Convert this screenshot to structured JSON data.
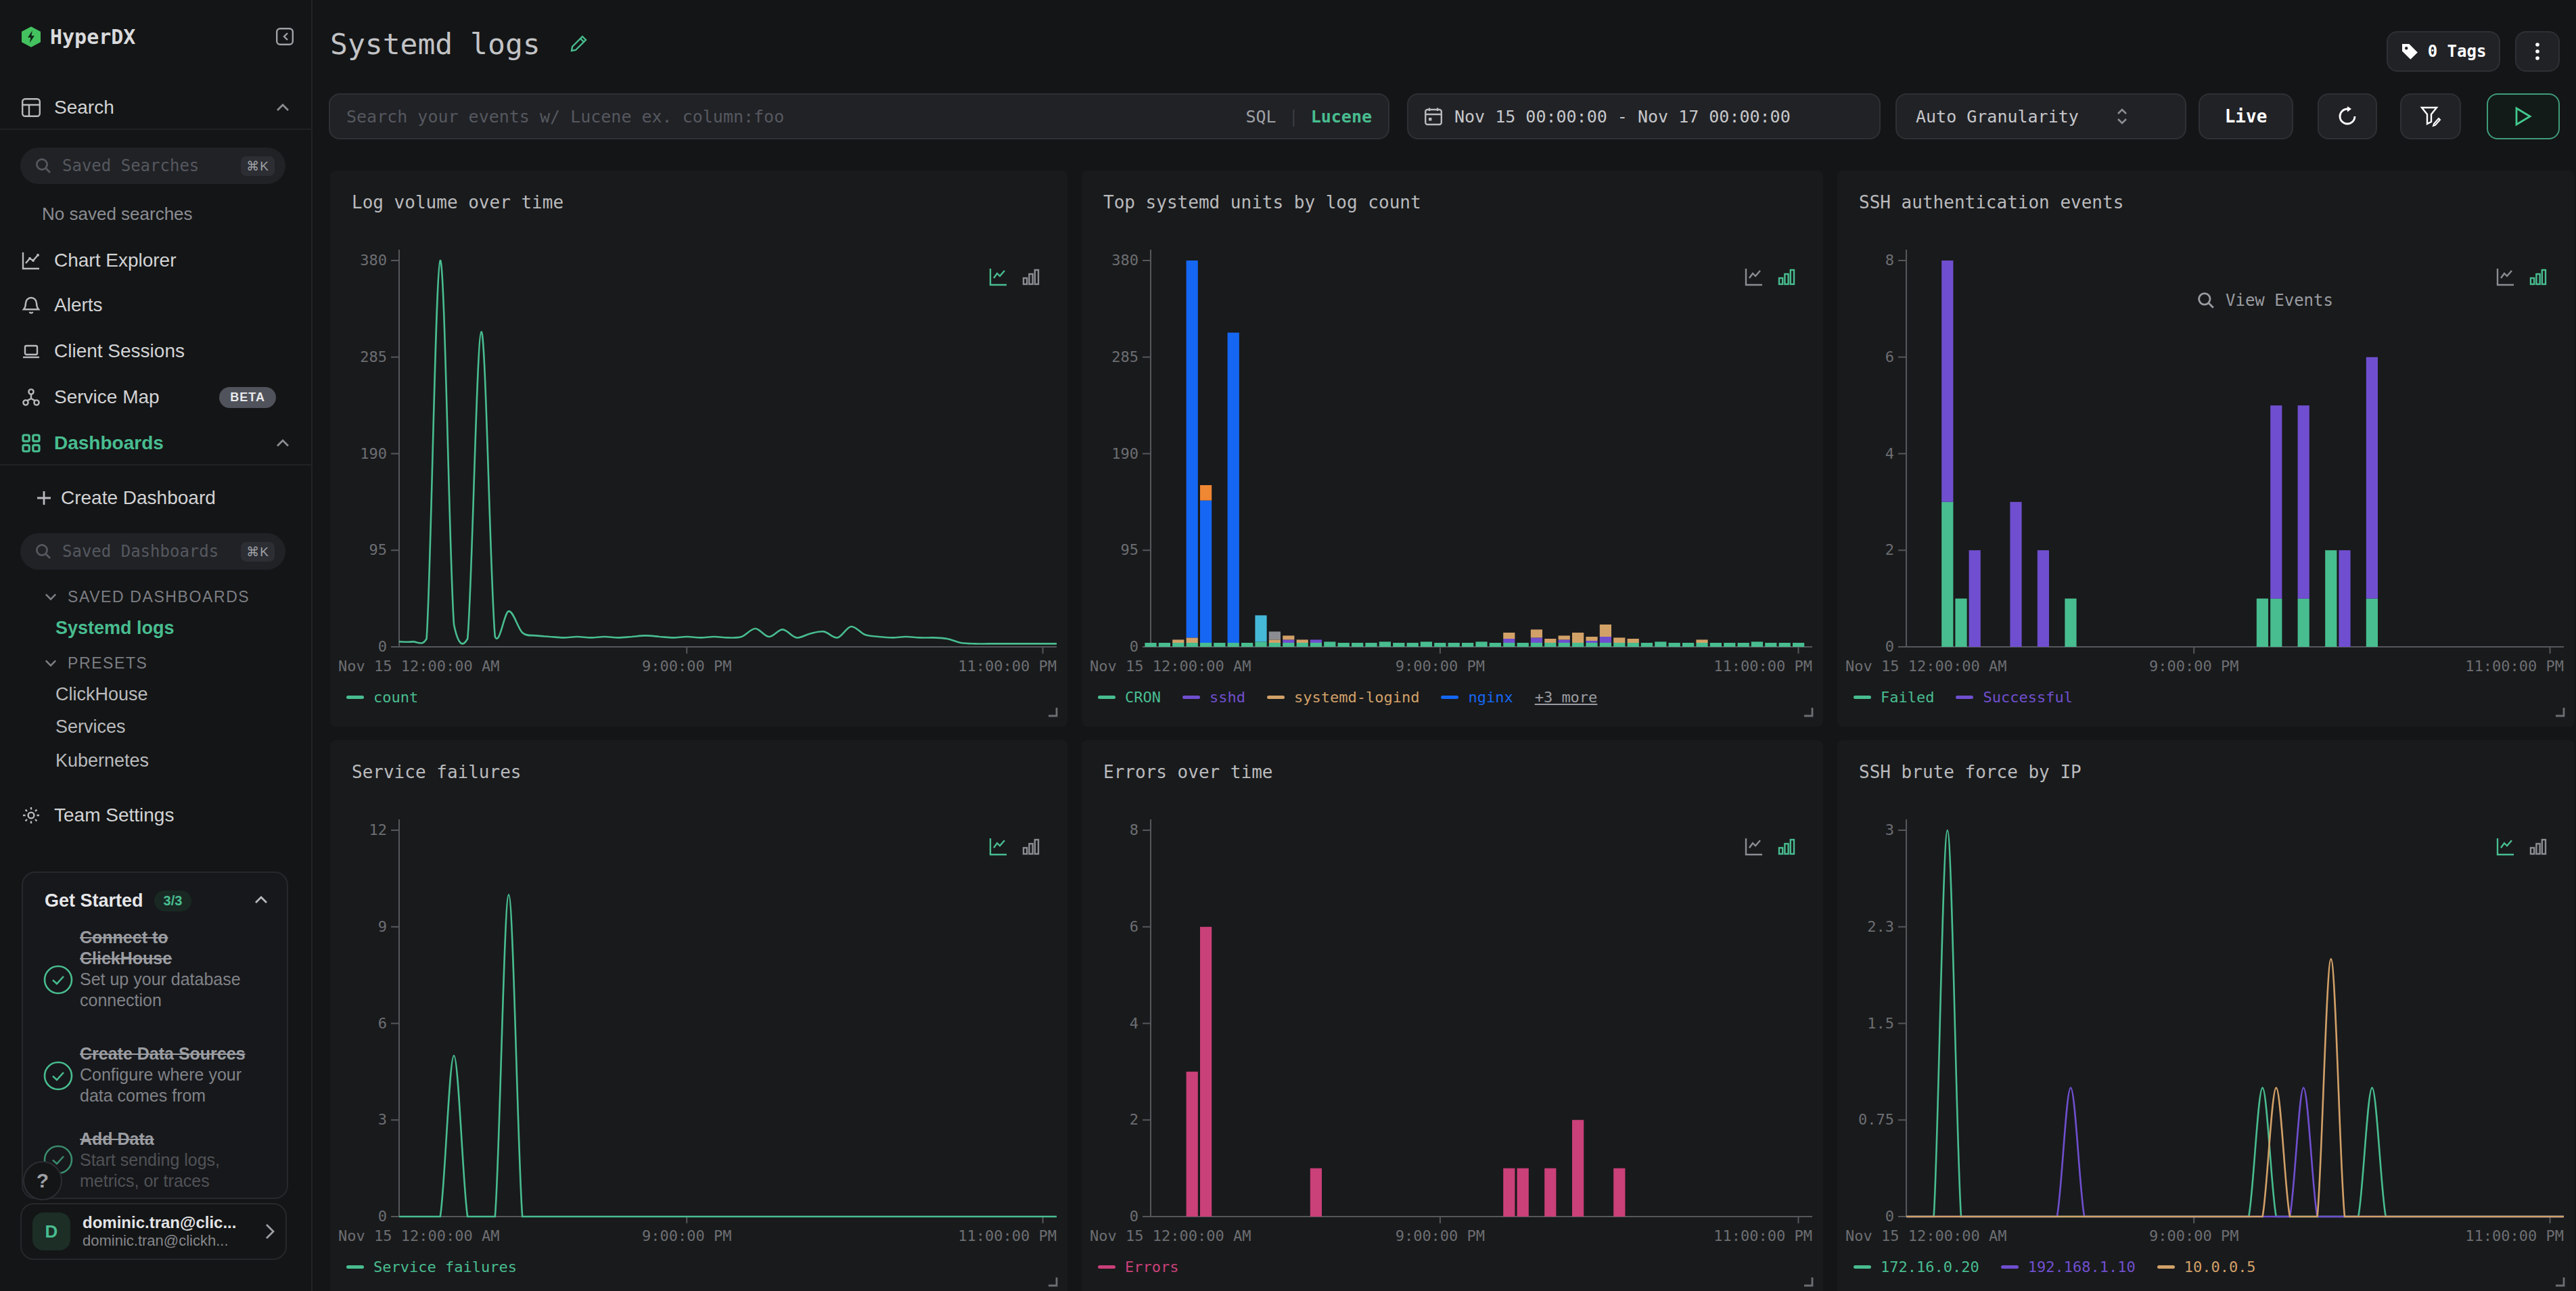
{
  "sidebar": {
    "logo": "HyperDX",
    "nav": [
      {
        "label": "Search"
      },
      {
        "label": "Chart Explorer"
      },
      {
        "label": "Alerts"
      },
      {
        "label": "Client Sessions"
      },
      {
        "label": "Service Map",
        "badge": "BETA"
      },
      {
        "label": "Dashboards"
      }
    ],
    "saved_searches": {
      "placeholder": "Saved Searches",
      "kbd": "⌘K"
    },
    "no_saved_searches": "No saved searches",
    "create_dashboard": "Create Dashboard",
    "saved_dashboards": {
      "placeholder": "Saved Dashboards",
      "kbd": "⌘K"
    },
    "sections": {
      "saved": "SAVED DASHBOARDS",
      "presets": "PRESETS"
    },
    "saved_dashboard_items": [
      "Systemd logs"
    ],
    "preset_items": [
      "ClickHouse",
      "Services",
      "Kubernetes"
    ],
    "team_settings": "Team Settings",
    "get_started": {
      "title": "Get Started",
      "progress": "3/3",
      "items": [
        {
          "title": "Connect to ClickHouse",
          "title_lines": [
            "Connect to",
            "ClickHouse"
          ],
          "subtitle_lines": [
            "Set up your database",
            "connection"
          ]
        },
        {
          "title": "Create Data Sources",
          "title_lines": [
            "Create Data Sources"
          ],
          "subtitle_lines": [
            "Configure where your",
            "data comes from"
          ]
        },
        {
          "title": "Add Data",
          "title_lines": [
            "Add Data"
          ],
          "subtitle_lines": [
            "Start sending logs,",
            "metrics, or traces"
          ]
        }
      ]
    },
    "help": "?",
    "user": {
      "initial": "D",
      "name": "dominic.tran@clic...",
      "email": "dominic.tran@clickh..."
    }
  },
  "header": {
    "title": "Systemd logs",
    "tags": "0 Tags"
  },
  "toolbar": {
    "search_placeholder": "Search your events w/ Lucene ex. column:foo",
    "sql": "SQL",
    "divider": "|",
    "lucene": "Lucene",
    "date_range": "Nov 15 00:00:00 - Nov 17 00:00:00",
    "granularity": "Auto Granularity",
    "live": "Live"
  },
  "colors": {
    "accent": "#48bd90",
    "green": "#48bd90",
    "blue": "#1567f3",
    "purple": "#6f4fcf",
    "pink": "#ca4079",
    "tan": "#d2a168",
    "orange": "#ef8733",
    "cyan": "#45b8d8",
    "gray": "#8b8d93",
    "panel": "#191a1c",
    "bg": "#141516",
    "input": "#212226"
  },
  "chart_data": [
    {
      "type": "line",
      "title": "Log volume over time",
      "active_view": "line",
      "ylim": [
        0,
        380
      ],
      "yticks": [
        "0",
        "95",
        "190",
        "285",
        "380"
      ],
      "x_labels": [
        "Nov 15 12:00:00 AM",
        "9:00:00 PM",
        "11:00:00 PM"
      ],
      "legend": [
        {
          "label": "count",
          "color": "green"
        }
      ],
      "series": [
        {
          "name": "count",
          "color": "green",
          "values": [
            5,
            5,
            8,
            380,
            22,
            8,
            310,
            10,
            35,
            14,
            11,
            10,
            9,
            10,
            9,
            10,
            9,
            10,
            11,
            10,
            9,
            10,
            9,
            10,
            9,
            10,
            18,
            10,
            17,
            9,
            13,
            15,
            9,
            20,
            12,
            10,
            9,
            10,
            9,
            9,
            8,
            4,
            3,
            3,
            3,
            3,
            3,
            3
          ]
        }
      ]
    },
    {
      "type": "bar",
      "title": "Top systemd units by log count",
      "active_view": "bar",
      "ylim": [
        0,
        380
      ],
      "yticks": [
        "0",
        "95",
        "190",
        "285",
        "380"
      ],
      "x_labels": [
        "Nov 15 12:00:00 AM",
        "9:00:00 PM",
        "11:00:00 PM"
      ],
      "legend": [
        {
          "label": "CRON",
          "color": "green"
        },
        {
          "label": "sshd",
          "color": "purple"
        },
        {
          "label": "systemd-logind",
          "color": "tan"
        },
        {
          "label": "nginx",
          "color": "blue"
        },
        {
          "label": "+3 more",
          "link": true
        }
      ],
      "series": [
        {
          "name": "CRON",
          "color": "green",
          "values": [
            4,
            4,
            4,
            4,
            4,
            4,
            4,
            4,
            5,
            4,
            4,
            4,
            4,
            5,
            4,
            4,
            4,
            5,
            4,
            4,
            5,
            4,
            4,
            4,
            5,
            4,
            4,
            4,
            4,
            4,
            4,
            4,
            4,
            4,
            4,
            4,
            4,
            5,
            4,
            4,
            4,
            4,
            4,
            4,
            5,
            4,
            4,
            4
          ]
        },
        {
          "name": "sshd",
          "color": "purple",
          "values": [
            0,
            0,
            0,
            0,
            0,
            0,
            0,
            0,
            0,
            0,
            3,
            0,
            3,
            0,
            0,
            0,
            0,
            0,
            0,
            0,
            0,
            0,
            0,
            0,
            0,
            0,
            4,
            0,
            5,
            0,
            3,
            0,
            2,
            6,
            0,
            0,
            0,
            0,
            0,
            0,
            0,
            0,
            0,
            0,
            0,
            0,
            0,
            0
          ]
        },
        {
          "name": "systemd-logind",
          "color": "tan",
          "values": [
            0,
            0,
            3,
            5,
            0,
            0,
            0,
            0,
            0,
            3,
            4,
            3,
            0,
            0,
            0,
            0,
            0,
            0,
            0,
            0,
            0,
            0,
            0,
            0,
            0,
            0,
            6,
            0,
            8,
            4,
            4,
            10,
            4,
            12,
            5,
            4,
            0,
            0,
            0,
            0,
            3,
            0,
            0,
            0,
            0,
            0,
            0,
            0
          ]
        },
        {
          "name": "nginx",
          "color": "blue",
          "values": [
            0,
            0,
            0,
            371,
            140,
            0,
            305,
            0,
            0,
            0,
            0,
            0,
            0,
            0,
            0,
            0,
            0,
            0,
            0,
            0,
            0,
            0,
            0,
            0,
            0,
            0,
            0,
            0,
            0,
            0,
            0,
            0,
            0,
            0,
            0,
            0,
            0,
            0,
            0,
            0,
            0,
            0,
            0,
            0,
            0,
            0,
            0,
            0
          ]
        },
        {
          "name": null,
          "color": "orange",
          "values": [
            0,
            0,
            0,
            0,
            15,
            0,
            0,
            0,
            0,
            0,
            0,
            0,
            0,
            0,
            0,
            0,
            0,
            0,
            0,
            0,
            0,
            0,
            0,
            0,
            0,
            0,
            0,
            0,
            0,
            0,
            0,
            0,
            0,
            0,
            0,
            0,
            0,
            0,
            0,
            0,
            0,
            0,
            0,
            0,
            0,
            0,
            0,
            0
          ]
        },
        {
          "name": null,
          "color": "cyan",
          "values": [
            0,
            0,
            0,
            0,
            0,
            0,
            0,
            0,
            26,
            0,
            0,
            0,
            0,
            0,
            0,
            0,
            0,
            0,
            0,
            0,
            0,
            0,
            0,
            0,
            0,
            0,
            0,
            0,
            0,
            0,
            0,
            0,
            0,
            0,
            0,
            0,
            0,
            0,
            0,
            0,
            0,
            0,
            0,
            0,
            0,
            0,
            0,
            0
          ]
        },
        {
          "name": null,
          "color": "gray",
          "values": [
            0,
            0,
            0,
            0,
            0,
            0,
            0,
            0,
            0,
            8,
            0,
            0,
            0,
            0,
            0,
            0,
            0,
            0,
            0,
            0,
            0,
            0,
            0,
            0,
            0,
            0,
            0,
            0,
            0,
            0,
            0,
            0,
            0,
            0,
            0,
            0,
            0,
            0,
            0,
            0,
            0,
            0,
            0,
            0,
            0,
            0,
            0,
            0
          ]
        }
      ]
    },
    {
      "type": "bar",
      "title": "SSH authentication events",
      "active_view": "bar",
      "overlay": "View Events",
      "ylim": [
        0,
        8
      ],
      "yticks": [
        "0",
        "2",
        "4",
        "6",
        "8"
      ],
      "x_labels": [
        "Nov 15 12:00:00 AM",
        "9:00:00 PM",
        "11:00:00 PM"
      ],
      "legend": [
        {
          "label": "Failed",
          "color": "green"
        },
        {
          "label": "Successful",
          "color": "purple"
        }
      ],
      "series": [
        {
          "name": "Failed",
          "color": "green",
          "values": [
            0,
            0,
            0,
            3,
            1,
            0,
            0,
            0,
            0,
            0,
            0,
            0,
            1,
            0,
            0,
            0,
            0,
            0,
            0,
            0,
            0,
            0,
            0,
            0,
            0,
            0,
            1,
            1,
            0,
            1,
            0,
            2,
            0,
            0,
            1,
            0,
            0,
            0,
            0,
            0,
            0,
            0,
            0,
            0,
            0,
            0,
            0,
            0
          ]
        },
        {
          "name": "Successful",
          "color": "purple",
          "values": [
            0,
            0,
            0,
            5,
            0,
            2,
            0,
            0,
            3,
            0,
            2,
            0,
            0,
            0,
            0,
            0,
            0,
            0,
            0,
            0,
            0,
            0,
            0,
            0,
            0,
            0,
            0,
            4,
            0,
            4,
            0,
            0,
            2,
            0,
            5,
            0,
            0,
            0,
            0,
            0,
            0,
            0,
            0,
            0,
            0,
            0,
            0,
            0
          ]
        }
      ]
    },
    {
      "type": "line",
      "title": "Service failures",
      "active_view": "line",
      "ylim": [
        0,
        12
      ],
      "yticks": [
        "0",
        "3",
        "6",
        "9",
        "12"
      ],
      "x_labels": [
        "Nov 15 12:00:00 AM",
        "9:00:00 PM",
        "11:00:00 PM"
      ],
      "legend": [
        {
          "label": "Service failures",
          "color": "green"
        }
      ],
      "series": [
        {
          "name": "Service failures",
          "color": "green",
          "values": [
            0,
            0,
            0,
            0,
            5,
            0,
            0,
            0,
            10,
            0,
            0,
            0,
            0,
            0,
            0,
            0,
            0,
            0,
            0,
            0,
            0,
            0,
            0,
            0,
            0,
            0,
            0,
            0,
            0,
            0,
            0,
            0,
            0,
            0,
            0,
            0,
            0,
            0,
            0,
            0,
            0,
            0,
            0,
            0,
            0,
            0,
            0,
            0
          ]
        }
      ]
    },
    {
      "type": "bar",
      "title": "Errors over time",
      "active_view": "bar",
      "ylim": [
        0,
        8
      ],
      "yticks": [
        "0",
        "2",
        "4",
        "6",
        "8"
      ],
      "x_labels": [
        "Nov 15 12:00:00 AM",
        "9:00:00 PM",
        "11:00:00 PM"
      ],
      "legend": [
        {
          "label": "Errors",
          "color": "pink"
        }
      ],
      "series": [
        {
          "name": "Errors",
          "color": "pink",
          "values": [
            0,
            0,
            0,
            3,
            6,
            0,
            0,
            0,
            0,
            0,
            0,
            0,
            1,
            0,
            0,
            0,
            0,
            0,
            0,
            0,
            0,
            0,
            0,
            0,
            0,
            0,
            1,
            1,
            0,
            1,
            0,
            2,
            0,
            0,
            1,
            0,
            0,
            0,
            0,
            0,
            0,
            0,
            0,
            0,
            0,
            0,
            0,
            0
          ]
        }
      ]
    },
    {
      "type": "line",
      "title": "SSH brute force by IP",
      "active_view": "line",
      "ylim": [
        0,
        3
      ],
      "yticks": [
        "0",
        "0.75",
        "1.5",
        "2.3",
        "3"
      ],
      "x_labels": [
        "Nov 15 12:00:00 AM",
        "9:00:00 PM",
        "11:00:00 PM"
      ],
      "legend": [
        {
          "label": "172.16.0.20",
          "color": "green"
        },
        {
          "label": "192.168.1.10",
          "color": "purple"
        },
        {
          "label": "10.0.0.5",
          "color": "tan"
        }
      ],
      "series": [
        {
          "name": "172.16.0.20",
          "color": "green",
          "values": [
            0,
            0,
            0,
            3,
            0,
            0,
            0,
            0,
            0,
            0,
            0,
            0,
            0,
            0,
            0,
            0,
            0,
            0,
            0,
            0,
            0,
            0,
            0,
            0,
            0,
            0,
            1,
            0,
            0,
            0,
            0,
            0,
            0,
            0,
            1,
            0,
            0,
            0,
            0,
            0,
            0,
            0,
            0,
            0,
            0,
            0,
            0,
            0
          ]
        },
        {
          "name": "192.168.1.10",
          "color": "purple",
          "values": [
            0,
            0,
            0,
            0,
            0,
            0,
            0,
            0,
            0,
            0,
            0,
            0,
            1,
            0,
            0,
            0,
            0,
            0,
            0,
            0,
            0,
            0,
            0,
            0,
            0,
            0,
            0,
            0,
            0,
            1,
            0,
            0,
            0,
            0,
            0,
            0,
            0,
            0,
            0,
            0,
            0,
            0,
            0,
            0,
            0,
            0,
            0,
            0
          ]
        },
        {
          "name": "10.0.0.5",
          "color": "tan",
          "values": [
            0,
            0,
            0,
            0,
            0,
            0,
            0,
            0,
            0,
            0,
            0,
            0,
            0,
            0,
            0,
            0,
            0,
            0,
            0,
            0,
            0,
            0,
            0,
            0,
            0,
            0,
            0,
            1,
            0,
            0,
            0,
            2,
            0,
            0,
            0,
            0,
            0,
            0,
            0,
            0,
            0,
            0,
            0,
            0,
            0,
            0,
            0,
            0
          ]
        }
      ]
    }
  ]
}
